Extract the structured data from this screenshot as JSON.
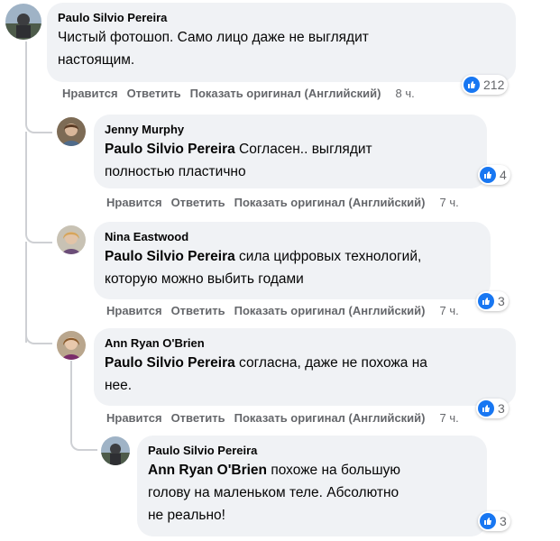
{
  "actions": {
    "like": "Нравится",
    "reply": "Ответить",
    "show_original": "Показать оригинал (Английский)"
  },
  "comments": [
    {
      "author": "Paulo Silvio Pereira",
      "mention": "",
      "text_lines": [
        "Чистый фотошоп. Само лицо даже не выглядит",
        "настоящим."
      ],
      "reactions": "212",
      "time": "8 ч."
    },
    {
      "author": "Jenny Murphy",
      "mention": "Paulo Silvio Pereira",
      "text_lines": [
        "Согласен.. выглядит",
        "полностью пластично"
      ],
      "reactions": "4",
      "time": "7 ч."
    },
    {
      "author": "Nina Eastwood",
      "mention": "Paulo Silvio Pereira",
      "text_lines": [
        "сила цифровых технологий,",
        "которую можно выбить годами"
      ],
      "reactions": "3",
      "time": "7 ч."
    },
    {
      "author": "Ann Ryan O'Brien",
      "mention": "Paulo Silvio Pereira",
      "text_lines": [
        "согласна, даже не похожа на",
        "нее."
      ],
      "reactions": "3",
      "time": "7 ч."
    },
    {
      "author": "Paulo Silvio Pereira",
      "mention": "Ann Ryan O'Brien",
      "text_lines": [
        "похоже на большую",
        "голову на маленьком теле. Абсолютно",
        "не реально!"
      ],
      "reactions": "3",
      "time": ""
    }
  ],
  "colors": {
    "bubble": "#f0f2f5",
    "like_blue": "#1877f2",
    "meta_gray": "#65676b"
  }
}
